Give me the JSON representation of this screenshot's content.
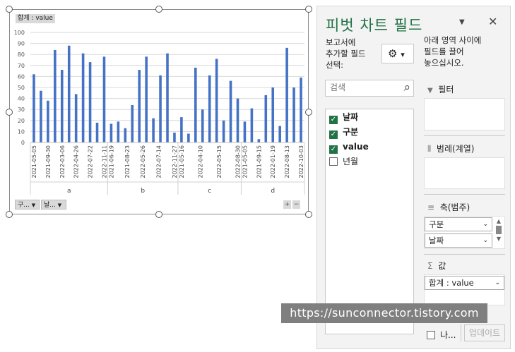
{
  "chart": {
    "sum_tag": "합계 : value",
    "filter_buttons": [
      "구...",
      "날..."
    ],
    "expand_button": "+",
    "collapse_button": "−"
  },
  "chart_data": {
    "type": "bar",
    "title": "",
    "xlabel": "",
    "ylabel": "",
    "ylim": [
      0,
      100
    ],
    "yticks": [
      0,
      10,
      20,
      30,
      40,
      50,
      60,
      70,
      80,
      90,
      100
    ],
    "grid": true,
    "legend": "none",
    "color": "#4472c4",
    "groups": [
      "a",
      "b",
      "c",
      "d"
    ],
    "date_labels": [
      [
        "2021-05-05",
        "2021-09-30",
        "2022-03-06",
        "2022-04-26",
        "2022-07-22",
        "2022-11-11"
      ],
      [
        "2021-06-19",
        "2021-08-23",
        "2022-05-26",
        "2022-07-14",
        "2022-11-27"
      ],
      [
        "2021-05-16",
        "2022-04-10",
        "2022-05-15",
        "2022-08-30"
      ],
      [
        "2021-05-05",
        "2021-09-15",
        "2022-01-19",
        "2022-08-13",
        "2022-10-03"
      ]
    ],
    "series": [
      {
        "group": "a",
        "values": [
          62,
          47,
          38,
          84,
          66,
          88,
          44,
          81,
          73,
          18,
          78
        ]
      },
      {
        "group": "b",
        "values": [
          17,
          19,
          13,
          34,
          66,
          78,
          22,
          61,
          81,
          9
        ]
      },
      {
        "group": "c",
        "values": [
          23,
          8,
          68,
          30,
          61,
          76,
          20,
          56,
          40
        ]
      },
      {
        "group": "d",
        "values": [
          19,
          31,
          3,
          43,
          50,
          15,
          86,
          50,
          59
        ]
      }
    ]
  },
  "pane": {
    "title": "피벗 차트 필드",
    "dropdown_icon": "▼",
    "close_icon": "✕",
    "choose_fields_label": [
      "보고서에",
      "추가할 필드",
      "선택:"
    ],
    "gear_icon": "⚙",
    "gear_dropdown": "▾",
    "area_hint": [
      "아래 영역 사이에",
      "필드를 끌어",
      "놓으십시오."
    ],
    "search_placeholder": "검색",
    "search_icon": "⌕",
    "fields": [
      {
        "label": "날짜",
        "checked": true
      },
      {
        "label": "구분",
        "checked": true
      },
      {
        "label": "value",
        "checked": true
      },
      {
        "label": "년월",
        "checked": false
      }
    ],
    "areas": {
      "filter": {
        "icon": "▼",
        "label": "필터"
      },
      "legend": {
        "icon": "⦀",
        "label": "범례(계열)"
      },
      "axis": {
        "icon": "≡",
        "label": "축(범주)",
        "items": [
          "구분",
          "날짜"
        ]
      },
      "values": {
        "icon": "Σ",
        "label": "값",
        "items": [
          "합계 : value"
        ]
      }
    },
    "defer_label": "나...",
    "update_button": "업데이트"
  },
  "watermark": "https://sunconnector.tistory.com"
}
